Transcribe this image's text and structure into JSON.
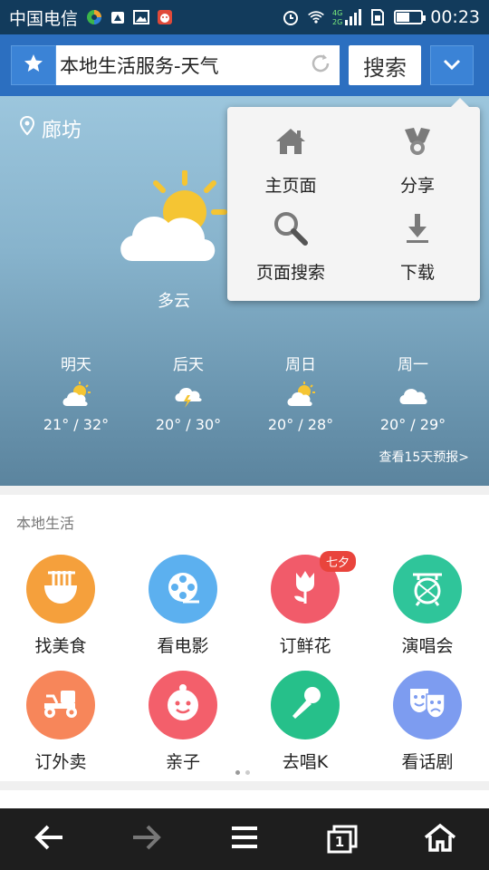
{
  "status_bar": {
    "carrier": "中国电信",
    "network": "4G 2G",
    "time": "00:23",
    "battery_level": 0.55
  },
  "address_bar": {
    "url_text": "本地生活服务-天气",
    "search_label": "搜索",
    "favorite_icon": "star-icon",
    "menu_icon": "chevron-down-icon"
  },
  "weather": {
    "city": "廊坊",
    "condition": "多云",
    "forecast": [
      {
        "day": "明天",
        "temp": "21° / 32°",
        "icon": "partly-cloudy-icon"
      },
      {
        "day": "后天",
        "temp": "20° / 30°",
        "icon": "thunderstorm-icon"
      },
      {
        "day": "周日",
        "temp": "20° / 28°",
        "icon": "partly-cloudy-icon"
      },
      {
        "day": "周一",
        "temp": "20° / 29°",
        "icon": "cloudy-icon"
      }
    ],
    "more_link": "查看15天预报>"
  },
  "dropdown_menu": {
    "items": [
      {
        "label": "主页面",
        "icon": "home-icon"
      },
      {
        "label": "分享",
        "icon": "share-icon"
      },
      {
        "label": "页面搜索",
        "icon": "search-icon"
      },
      {
        "label": "下载",
        "icon": "download-icon"
      }
    ]
  },
  "local_life": {
    "title": "本地生活",
    "items": [
      {
        "label": "找美食",
        "color": "#f5a03c",
        "icon": "noodle-bowl-icon"
      },
      {
        "label": "看电影",
        "color": "#5cb0ef",
        "icon": "film-reel-icon"
      },
      {
        "label": "订鲜花",
        "color": "#f15b6a",
        "icon": "tulip-icon",
        "badge": "七夕"
      },
      {
        "label": "演唱会",
        "color": "#2fc59a",
        "icon": "drum-icon"
      },
      {
        "label": "订外卖",
        "color": "#f7865a",
        "icon": "scooter-icon"
      },
      {
        "label": "亲子",
        "color": "#f35f6b",
        "icon": "baby-icon"
      },
      {
        "label": "去唱K",
        "color": "#26c08a",
        "icon": "microphone-icon"
      },
      {
        "label": "看话剧",
        "color": "#7d9cf0",
        "icon": "theater-masks-icon"
      }
    ],
    "page_count": 2,
    "current_page": 1
  },
  "bottom_nav": {
    "items": [
      "back-arrow-icon",
      "forward-arrow-icon",
      "menu-icon",
      "tabs-icon",
      "home-icon"
    ],
    "tab_count": "1"
  }
}
